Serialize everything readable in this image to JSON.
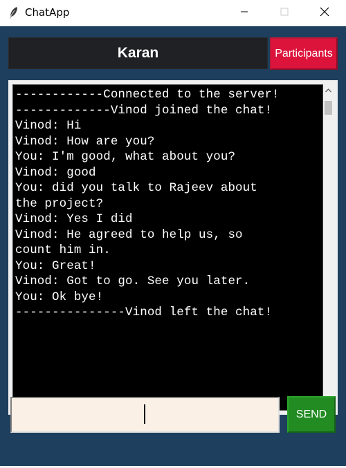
{
  "window": {
    "title": "ChatApp",
    "icon": "feather-icon"
  },
  "header": {
    "name": "Karan",
    "participants_label": "Participants"
  },
  "chat": {
    "lines": [
      "------------Connected to the server!",
      "-------------Vinod joined the chat!",
      "Vinod: Hi",
      "Vinod: How are you?",
      "You: I'm good, what about you?",
      "Vinod: good",
      "You: did you talk to Rajeev about",
      "the project?",
      "Vinod: Yes I did",
      "Vinod: He agreed to help us, so",
      "count him in.",
      "You: Great!",
      "Vinod: Got to go. See you later.",
      "You: Ok bye!",
      "---------------Vinod left the chat!"
    ]
  },
  "composer": {
    "value": "",
    "send_label": "SEND"
  },
  "colors": {
    "background": "#1e3f5e",
    "header": "#202124",
    "participants": "#dc143c",
    "send": "#228b22",
    "input": "#faf0e6",
    "chat": "#000000"
  }
}
